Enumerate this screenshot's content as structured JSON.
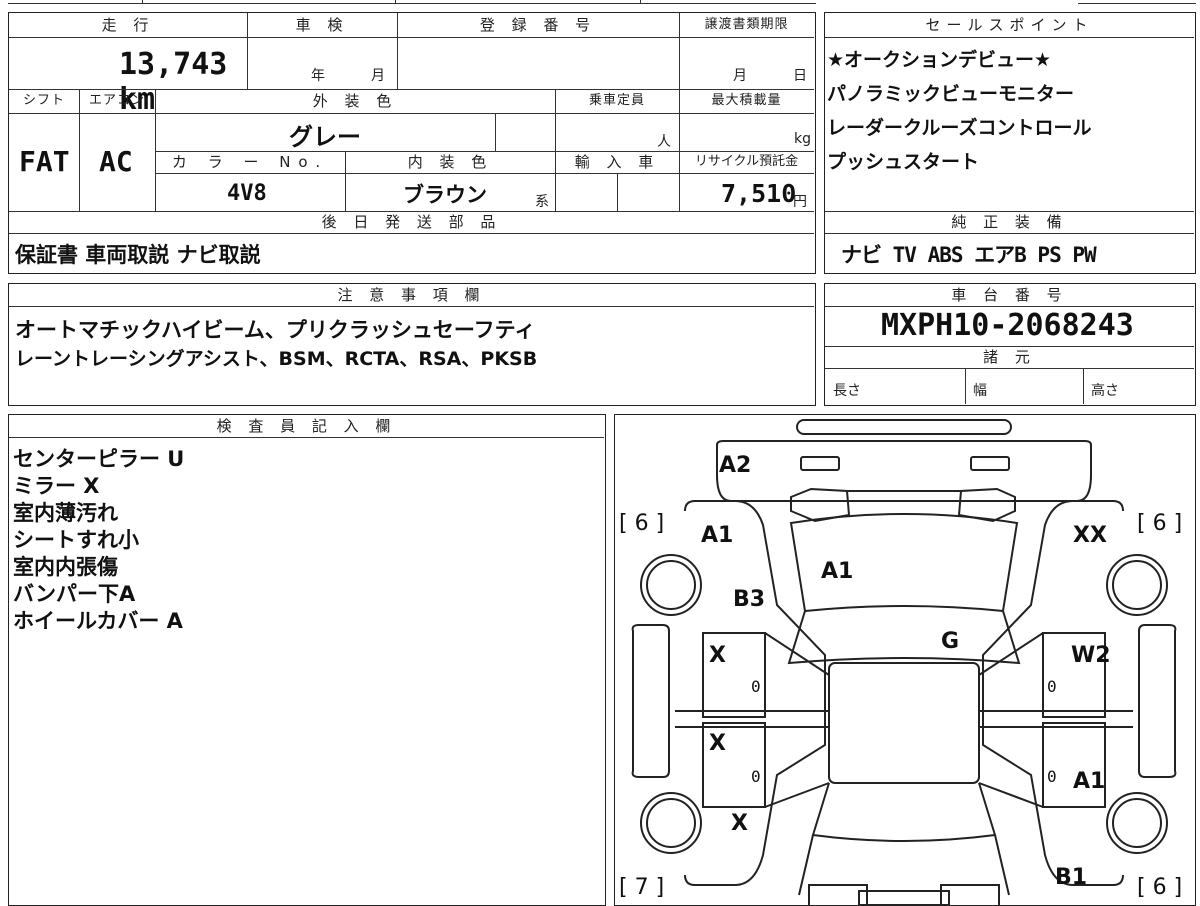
{
  "vehicle_info": {
    "mileage_label": "走 行",
    "mileage_value": "13,743 km",
    "inspection_label": "車 検",
    "inspection_year_unit": "年",
    "inspection_month_unit": "月",
    "registration_label": "登 録 番 号",
    "transfer_deadline_label": "譲渡書類期限",
    "transfer_month_unit": "月",
    "transfer_day_unit": "日",
    "shift_label": "シフト",
    "shift_value": "FAT",
    "ac_label": "エアコン",
    "ac_value": "AC",
    "exterior_color_label": "外 装 色",
    "exterior_color_value": "グレー",
    "capacity_label": "乗車定員",
    "capacity_unit": "人",
    "max_load_label": "最大積載量",
    "max_load_unit": "kg",
    "color_no_label": "カ ラ ー No.",
    "color_no_value": "4V8",
    "interior_color_label": "内 装 色",
    "interior_color_value": "ブラウン",
    "interior_color_suffix": "系",
    "import_label": "輸 入 車",
    "recycle_label": "リサイクル預託金",
    "recycle_value": "7,510",
    "recycle_unit": "円",
    "later_parts_label": "後 日 発 送 部 品",
    "later_parts_value": "保証書 車両取説 ナビ取説"
  },
  "sales_points": {
    "label": "セールスポイント",
    "lines": [
      "★オークションデビュー★",
      "パノラミックビューモニター",
      "レーダークルーズコントロール",
      "プッシュスタート"
    ]
  },
  "equipment": {
    "label": "純 正 装 備",
    "value": "ナビ TV ABS エアB PS PW"
  },
  "notes": {
    "label": "注 意 事 項 欄",
    "lines": [
      "オートマチックハイビーム、プリクラッシュセーフティ",
      "レーントレーシングアシスト、BSM、RCTA、RSA、PKSB"
    ]
  },
  "chassis": {
    "label": "車 台 番 号",
    "value": "MXPH10-2068243",
    "specs_label": "諸 元",
    "length_label": "長さ",
    "width_label": "幅",
    "height_label": "高さ"
  },
  "inspector": {
    "label": "検 査 員 記 入 欄",
    "lines": [
      "センターピラー U",
      "ミラー X",
      "室内薄汚れ",
      "シートすれ小",
      "室内内張傷",
      "バンパー下A",
      "ホイールカバー A"
    ]
  },
  "diagram": {
    "marks": [
      "A2",
      "A1",
      "A1",
      "B3",
      "XX",
      "G",
      "X",
      "X",
      "X",
      "W2",
      "A1",
      "B1"
    ],
    "tires": [
      "[ 6 ]",
      "[ 6 ]",
      "[ 7 ]",
      "[ 6 ]"
    ],
    "zeros": [
      "0",
      "0",
      "0",
      "0"
    ]
  }
}
